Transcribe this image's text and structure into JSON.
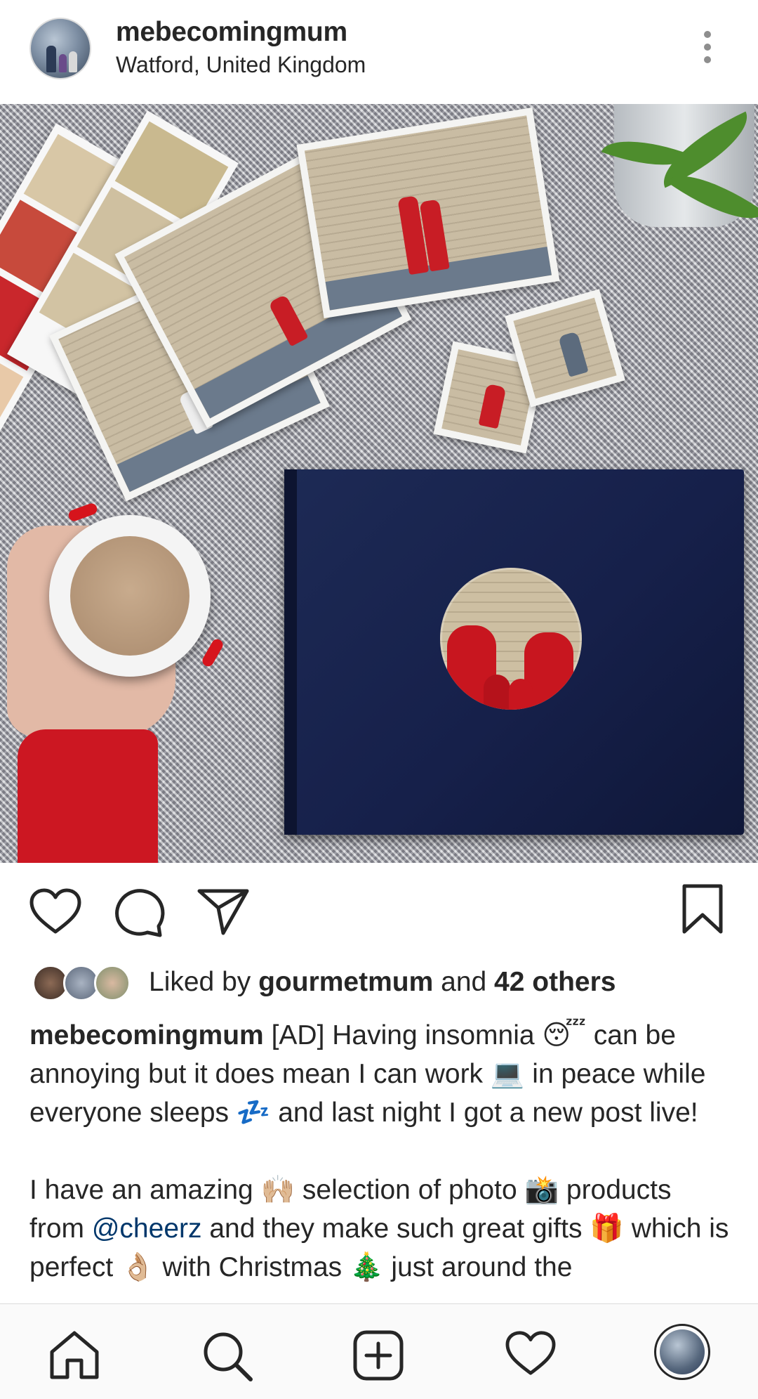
{
  "post": {
    "username": "mebecomingmum",
    "location": "Watford, United Kingdom"
  },
  "likes": {
    "prefix": "Liked by ",
    "user": "gourmetmum",
    "joiner": " and ",
    "others": "42 others"
  },
  "caption": {
    "username": "mebecomingmum",
    "line1": " [AD] Having insomnia 😴 can be annoying but it does mean I can work 💻 in peace while everyone sleeps 💤 and last night I got a new post live!",
    "line2_before": "I have an amazing 🙌🏼 selection of photo 📸 products from ",
    "mention": "@cheerz",
    "line2_after": " and they make such great gifts 🎁 which is perfect 👌🏼 with Christmas 🎄 just around the"
  },
  "icons": {
    "more": "more-vertical-icon",
    "tag": "user-tag-icon",
    "like": "heart-icon",
    "comment": "comment-icon",
    "share": "paper-plane-icon",
    "save": "bookmark-icon",
    "nav_home": "home-icon",
    "nav_search": "search-icon",
    "nav_add": "add-post-icon",
    "nav_activity": "heart-icon",
    "nav_profile": "profile-avatar"
  },
  "colors": {
    "text": "#262626",
    "mention": "#00376b",
    "album": "#1d2a55",
    "sweater_red": "#cc1722"
  }
}
